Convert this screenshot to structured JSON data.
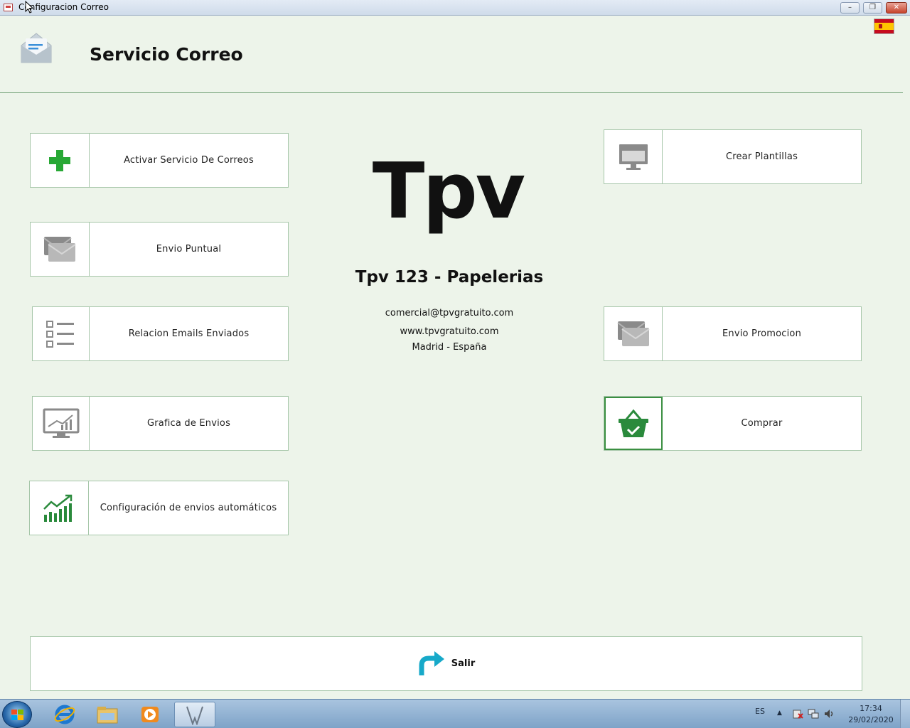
{
  "window": {
    "title": "Configuracion Correo",
    "controls": {
      "minimize": "–",
      "maximize": "❐",
      "close": "✕"
    }
  },
  "header": {
    "title": "Servicio Correo",
    "icon": "envelope-icon",
    "language_flag": "spain-flag-icon"
  },
  "left_buttons": [
    {
      "label": "Activar Servicio De Correos",
      "icon": "green-plus-icon"
    },
    {
      "label": "Envio Puntual",
      "icon": "mail-envelope-icon"
    },
    {
      "label": "Relacion Emails Enviados",
      "icon": "checklist-icon"
    },
    {
      "label": "Grafica de Envios",
      "icon": "monitor-chart-icon"
    },
    {
      "label": "Configuración de envios automáticos",
      "icon": "bar-chart-trend-icon"
    }
  ],
  "right_buttons": [
    {
      "label": "Crear Plantillas",
      "icon": "monitor-window-icon"
    },
    {
      "label": "Envio Promocion",
      "icon": "mail-envelope-icon"
    },
    {
      "label": "Comprar",
      "icon": "shopping-basket-icon"
    }
  ],
  "center": {
    "logo": "Tpv",
    "company": "Tpv 123 - Papelerias",
    "email": "comercial@tpvgratuito.com",
    "website": "www.tpvgratuito.com",
    "location": "Madrid - España"
  },
  "exit": {
    "label": "Salir",
    "icon": "exit-arrow-icon"
  },
  "taskbar": {
    "apps": [
      "internet-explorer-icon",
      "file-explorer-icon",
      "media-player-icon",
      "tpv-app-icon"
    ],
    "language": "ES",
    "tray_arrow": "▲",
    "time": "17:34",
    "date": "29/02/2020"
  },
  "colors": {
    "background": "#edf4ea",
    "border": "#a6c6a9",
    "accent_green": "#3b8f42",
    "exit_icon": "#17a9c9"
  }
}
